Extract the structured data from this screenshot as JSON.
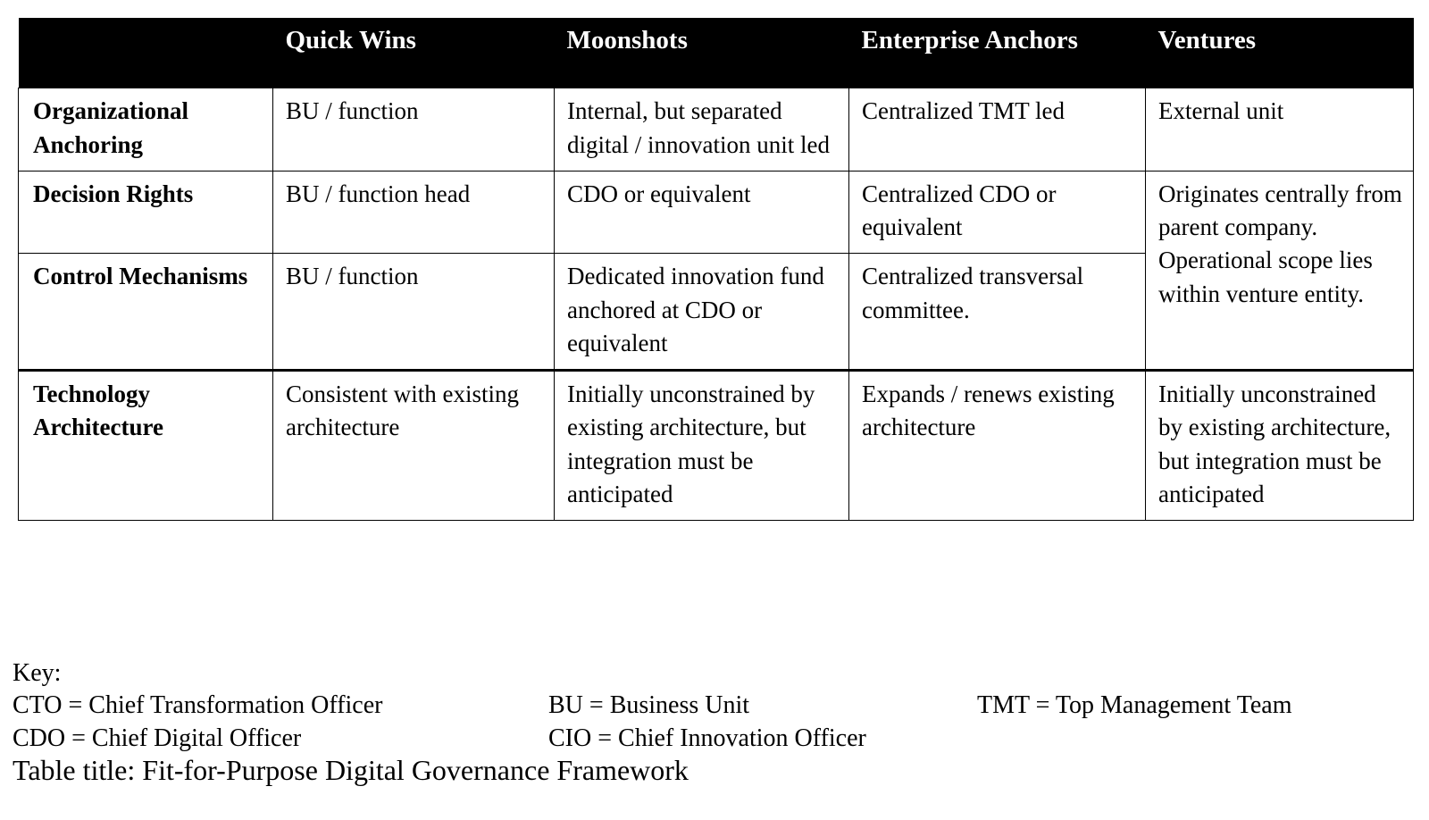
{
  "table": {
    "columns": [
      {
        "key": "dimension",
        "label": ""
      },
      {
        "key": "quick_wins",
        "label": "Quick Wins"
      },
      {
        "key": "moonshots",
        "label": "Moonshots"
      },
      {
        "key": "enterprise_anchors",
        "label": "Enterprise Anchors"
      },
      {
        "key": "ventures",
        "label": "Ventures"
      }
    ],
    "rows": [
      {
        "dimension": "Organizational Anchoring",
        "quick_wins": "BU / function",
        "moonshots": "Internal, but separated\ndigital / innovation unit led",
        "enterprise_anchors": "Centralized\nTMT led",
        "ventures": "External unit"
      },
      {
        "dimension": "Decision Rights",
        "quick_wins": "BU / function head",
        "moonshots": "CDO or equivalent",
        "enterprise_anchors": "Centralized\nCDO or equivalent",
        "ventures": "Originates centrally from parent company. Operational scope lies within venture entity."
      },
      {
        "dimension": "Control Mechanisms",
        "quick_wins": "BU / function",
        "moonshots": "Dedicated innovation fund anchored at CDO or equivalent",
        "enterprise_anchors": "Centralized transversal committee.",
        "ventures": ""
      },
      {
        "dimension": "Technology Architecture",
        "quick_wins": "Consistent with existing architecture",
        "moonshots": "Initially unconstrained by existing architecture, but integration must be anticipated",
        "enterprise_anchors": "Expands / renews existing architecture",
        "ventures": "Initially unconstrained by existing architecture, but integration must be anticipated"
      }
    ]
  },
  "key": {
    "heading": "Key:",
    "line1": {
      "col1": "CTO = Chief Transformation Officer",
      "col2": "BU = Business Unit",
      "col3": "TMT = Top Management Team"
    },
    "line2": {
      "col1": "CDO = Chief Digital Officer",
      "col2": "CIO = Chief Innovation Officer",
      "col3": ""
    }
  },
  "caption": "Table title: Fit-for-Purpose Digital Governance Framework",
  "colors": {
    "header_background": "#000000",
    "header_text": "#ffffff",
    "body_text": "#000000",
    "border": "#000000",
    "page_background": "#ffffff"
  }
}
